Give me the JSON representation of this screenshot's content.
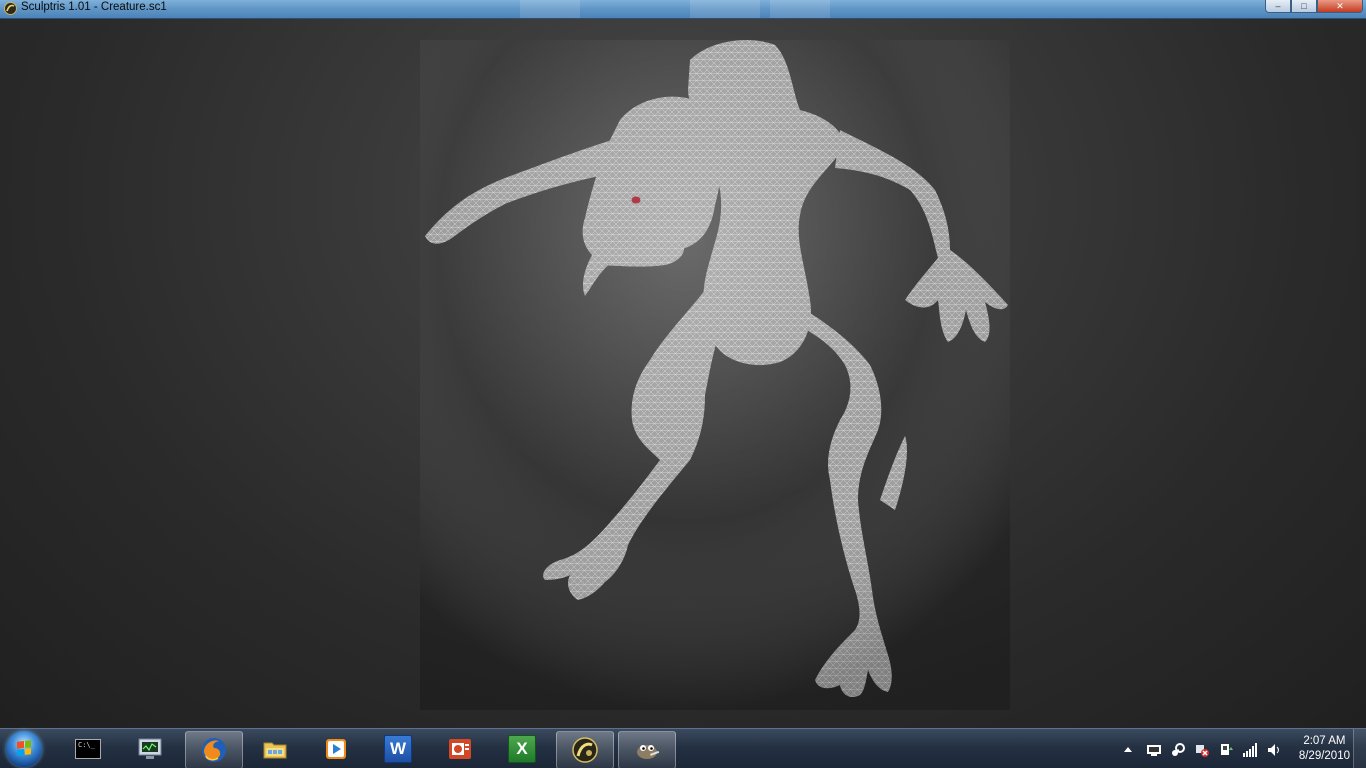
{
  "window": {
    "title": "Sculptris 1.01 - Creature.sc1",
    "buttons": {
      "minimize": "–",
      "maximize": "□",
      "close": "✕"
    }
  },
  "viewport": {
    "model": "creature-wireframe-mesh",
    "background_color": "#2e2e2e",
    "mesh_color": "#bdbdbd",
    "eye_color": "#b23a48"
  },
  "taskbar": {
    "start_button": "start-orb-icon",
    "pinned": [
      {
        "name": "command-prompt",
        "label": "C:\\_",
        "icon": "cmd-icon"
      },
      {
        "name": "computer-monitor",
        "icon": "monitor-icon"
      },
      {
        "name": "firefox",
        "icon": "firefox-icon",
        "active": true
      },
      {
        "name": "windows-explorer",
        "icon": "folder-icon"
      },
      {
        "name": "media-player",
        "icon": "play-icon"
      },
      {
        "name": "word",
        "label": "W",
        "icon": "word-icon"
      },
      {
        "name": "powerpoint",
        "icon": "powerpoint-icon"
      },
      {
        "name": "excel",
        "label": "X",
        "icon": "excel-icon"
      },
      {
        "name": "sculptris",
        "icon": "sculptris-icon",
        "active": true
      },
      {
        "name": "gimp",
        "icon": "gimp-icon",
        "active": true
      }
    ],
    "tray": {
      "icons": [
        "chevron-up-icon",
        "display-icon",
        "steam-icon",
        "network-error-icon",
        "safely-remove-icon",
        "signal-icon",
        "volume-icon"
      ],
      "time": "2:07 AM",
      "date": "8/29/2010"
    }
  }
}
